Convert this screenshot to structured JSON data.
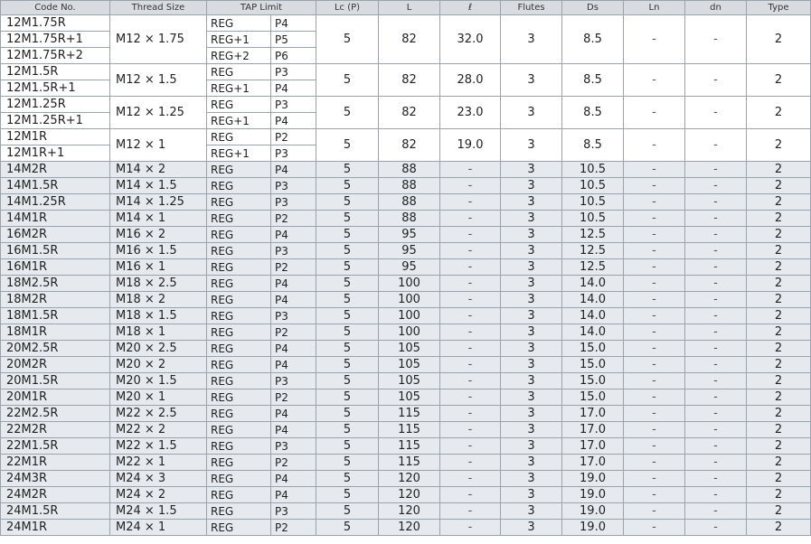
{
  "headers": [
    "Code No.",
    "Thread Size",
    "TAP Limit",
    "Lc (P)",
    "L",
    "ℓ",
    "Flutes",
    "Ds",
    "Ln",
    "dn",
    "Type"
  ],
  "groups": [
    {
      "thread": "M12 × 1.75",
      "lc": "5",
      "l": "82",
      "ell": "32.0",
      "flutes": "3",
      "ds": "8.5",
      "ln": "-",
      "dn": "-",
      "type": "2",
      "rows": [
        {
          "code": "12M1.75R",
          "tap": "REG",
          "p": "P4"
        },
        {
          "code": "12M1.75R+1",
          "tap": "REG+1",
          "p": "P5"
        },
        {
          "code": "12M1.75R+2",
          "tap": "REG+2",
          "p": "P6"
        }
      ]
    },
    {
      "thread": "M12 × 1.5",
      "lc": "5",
      "l": "82",
      "ell": "28.0",
      "flutes": "3",
      "ds": "8.5",
      "ln": "-",
      "dn": "-",
      "type": "2",
      "rows": [
        {
          "code": "12M1.5R",
          "tap": "REG",
          "p": "P3"
        },
        {
          "code": "12M1.5R+1",
          "tap": "REG+1",
          "p": "P4"
        }
      ]
    },
    {
      "thread": "M12 × 1.25",
      "lc": "5",
      "l": "82",
      "ell": "23.0",
      "flutes": "3",
      "ds": "8.5",
      "ln": "-",
      "dn": "-",
      "type": "2",
      "rows": [
        {
          "code": "12M1.25R",
          "tap": "REG",
          "p": "P3"
        },
        {
          "code": "12M1.25R+1",
          "tap": "REG+1",
          "p": "P4"
        }
      ]
    },
    {
      "thread": "M12 × 1",
      "lc": "5",
      "l": "82",
      "ell": "19.0",
      "flutes": "3",
      "ds": "8.5",
      "ln": "-",
      "dn": "-",
      "type": "2",
      "rows": [
        {
          "code": "12M1R",
          "tap": "REG",
          "p": "P2"
        },
        {
          "code": "12M1R+1",
          "tap": "REG+1",
          "p": "P3"
        }
      ]
    }
  ],
  "rows": [
    {
      "code": "14M2R",
      "thread": "M14 × 2",
      "tap": "REG",
      "p": "P4",
      "lc": "5",
      "l": "88",
      "ell": "-",
      "flutes": "3",
      "ds": "10.5",
      "ln": "-",
      "dn": "-",
      "type": "2"
    },
    {
      "code": "14M1.5R",
      "thread": "M14 × 1.5",
      "tap": "REG",
      "p": "P3",
      "lc": "5",
      "l": "88",
      "ell": "-",
      "flutes": "3",
      "ds": "10.5",
      "ln": "-",
      "dn": "-",
      "type": "2"
    },
    {
      "code": "14M1.25R",
      "thread": "M14 × 1.25",
      "tap": "REG",
      "p": "P3",
      "lc": "5",
      "l": "88",
      "ell": "-",
      "flutes": "3",
      "ds": "10.5",
      "ln": "-",
      "dn": "-",
      "type": "2"
    },
    {
      "code": "14M1R",
      "thread": "M14 × 1",
      "tap": "REG",
      "p": "P2",
      "lc": "5",
      "l": "88",
      "ell": "-",
      "flutes": "3",
      "ds": "10.5",
      "ln": "-",
      "dn": "-",
      "type": "2"
    },
    {
      "code": "16M2R",
      "thread": "M16 × 2",
      "tap": "REG",
      "p": "P4",
      "lc": "5",
      "l": "95",
      "ell": "-",
      "flutes": "3",
      "ds": "12.5",
      "ln": "-",
      "dn": "-",
      "type": "2"
    },
    {
      "code": "16M1.5R",
      "thread": "M16 × 1.5",
      "tap": "REG",
      "p": "P3",
      "lc": "5",
      "l": "95",
      "ell": "-",
      "flutes": "3",
      "ds": "12.5",
      "ln": "-",
      "dn": "-",
      "type": "2"
    },
    {
      "code": "16M1R",
      "thread": "M16 × 1",
      "tap": "REG",
      "p": "P2",
      "lc": "5",
      "l": "95",
      "ell": "-",
      "flutes": "3",
      "ds": "12.5",
      "ln": "-",
      "dn": "-",
      "type": "2"
    },
    {
      "code": "18M2.5R",
      "thread": "M18 × 2.5",
      "tap": "REG",
      "p": "P4",
      "lc": "5",
      "l": "100",
      "ell": "-",
      "flutes": "3",
      "ds": "14.0",
      "ln": "-",
      "dn": "-",
      "type": "2"
    },
    {
      "code": "18M2R",
      "thread": "M18 × 2",
      "tap": "REG",
      "p": "P4",
      "lc": "5",
      "l": "100",
      "ell": "-",
      "flutes": "3",
      "ds": "14.0",
      "ln": "-",
      "dn": "-",
      "type": "2"
    },
    {
      "code": "18M1.5R",
      "thread": "M18 × 1.5",
      "tap": "REG",
      "p": "P3",
      "lc": "5",
      "l": "100",
      "ell": "-",
      "flutes": "3",
      "ds": "14.0",
      "ln": "-",
      "dn": "-",
      "type": "2"
    },
    {
      "code": "18M1R",
      "thread": "M18 × 1",
      "tap": "REG",
      "p": "P2",
      "lc": "5",
      "l": "100",
      "ell": "-",
      "flutes": "3",
      "ds": "14.0",
      "ln": "-",
      "dn": "-",
      "type": "2"
    },
    {
      "code": "20M2.5R",
      "thread": "M20 × 2.5",
      "tap": "REG",
      "p": "P4",
      "lc": "5",
      "l": "105",
      "ell": "-",
      "flutes": "3",
      "ds": "15.0",
      "ln": "-",
      "dn": "-",
      "type": "2"
    },
    {
      "code": "20M2R",
      "thread": "M20 × 2",
      "tap": "REG",
      "p": "P4",
      "lc": "5",
      "l": "105",
      "ell": "-",
      "flutes": "3",
      "ds": "15.0",
      "ln": "-",
      "dn": "-",
      "type": "2"
    },
    {
      "code": "20M1.5R",
      "thread": "M20 × 1.5",
      "tap": "REG",
      "p": "P3",
      "lc": "5",
      "l": "105",
      "ell": "-",
      "flutes": "3",
      "ds": "15.0",
      "ln": "-",
      "dn": "-",
      "type": "2"
    },
    {
      "code": "20M1R",
      "thread": "M20 × 1",
      "tap": "REG",
      "p": "P2",
      "lc": "5",
      "l": "105",
      "ell": "-",
      "flutes": "3",
      "ds": "15.0",
      "ln": "-",
      "dn": "-",
      "type": "2"
    },
    {
      "code": "22M2.5R",
      "thread": "M22 × 2.5",
      "tap": "REG",
      "p": "P4",
      "lc": "5",
      "l": "115",
      "ell": "-",
      "flutes": "3",
      "ds": "17.0",
      "ln": "-",
      "dn": "-",
      "type": "2"
    },
    {
      "code": "22M2R",
      "thread": "M22 × 2",
      "tap": "REG",
      "p": "P4",
      "lc": "5",
      "l": "115",
      "ell": "-",
      "flutes": "3",
      "ds": "17.0",
      "ln": "-",
      "dn": "-",
      "type": "2"
    },
    {
      "code": "22M1.5R",
      "thread": "M22 × 1.5",
      "tap": "REG",
      "p": "P3",
      "lc": "5",
      "l": "115",
      "ell": "-",
      "flutes": "3",
      "ds": "17.0",
      "ln": "-",
      "dn": "-",
      "type": "2"
    },
    {
      "code": "22M1R",
      "thread": "M22 × 1",
      "tap": "REG",
      "p": "P2",
      "lc": "5",
      "l": "115",
      "ell": "-",
      "flutes": "3",
      "ds": "17.0",
      "ln": "-",
      "dn": "-",
      "type": "2"
    },
    {
      "code": "24M3R",
      "thread": "M24 × 3",
      "tap": "REG",
      "p": "P4",
      "lc": "5",
      "l": "120",
      "ell": "-",
      "flutes": "3",
      "ds": "19.0",
      "ln": "-",
      "dn": "-",
      "type": "2"
    },
    {
      "code": "24M2R",
      "thread": "M24 × 2",
      "tap": "REG",
      "p": "P4",
      "lc": "5",
      "l": "120",
      "ell": "-",
      "flutes": "3",
      "ds": "19.0",
      "ln": "-",
      "dn": "-",
      "type": "2"
    },
    {
      "code": "24M1.5R",
      "thread": "M24 × 1.5",
      "tap": "REG",
      "p": "P3",
      "lc": "5",
      "l": "120",
      "ell": "-",
      "flutes": "3",
      "ds": "19.0",
      "ln": "-",
      "dn": "-",
      "type": "2"
    },
    {
      "code": "24M1R",
      "thread": "M24 × 1",
      "tap": "REG",
      "p": "P2",
      "lc": "5",
      "l": "120",
      "ell": "-",
      "flutes": "3",
      "ds": "19.0",
      "ln": "-",
      "dn": "-",
      "type": "2"
    }
  ]
}
